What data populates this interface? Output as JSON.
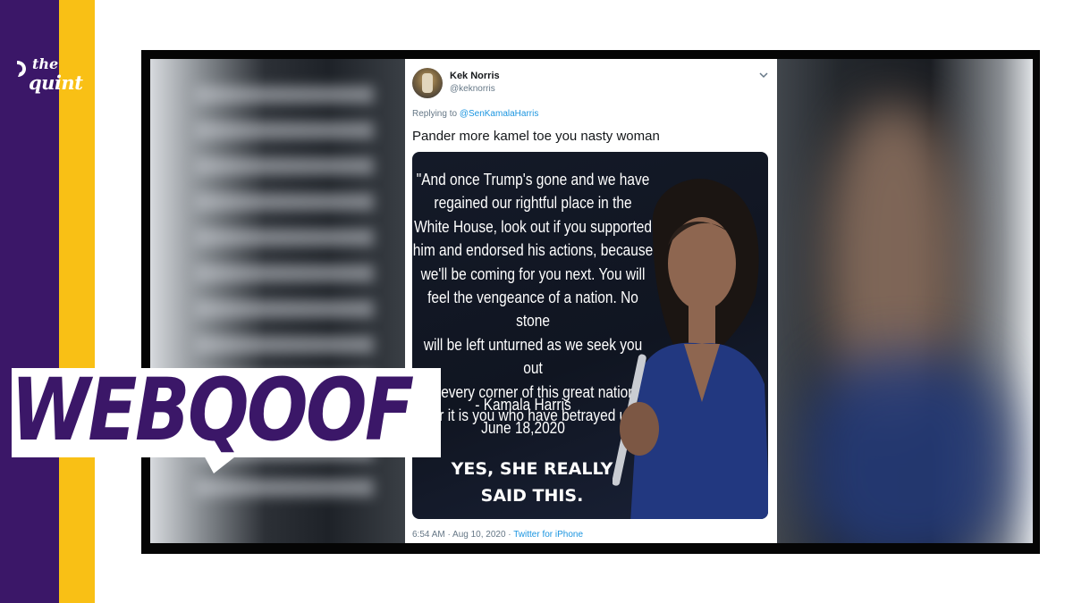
{
  "brand": {
    "logo_line1": "the",
    "logo_line2": "quint",
    "purple": "#3b1768",
    "yellow": "#f9c015"
  },
  "tweet": {
    "author_name": "Kek Norris",
    "author_handle": "@keknorris",
    "replying_prefix": "Replying to",
    "replying_to": "@SenKamalaHarris",
    "text": "Pander more kamel toe you nasty woman",
    "timestamp": "6:54 AM · Aug 10, 2020 · ",
    "source": "Twitter for iPhone",
    "menu_icon": "chevron-down-icon"
  },
  "meme": {
    "quote_lines": [
      "\"And once Trump's gone and we have",
      "regained our rightful place in the",
      "White House, look out if you supported",
      "him and endorsed his actions, because",
      "we'll be coming for you next. You will",
      "feel the vengeance of a nation. No stone",
      "will be left unturned as we seek you out",
      "in every corner of this great nation.",
      "For it is you who have betrayed us.\""
    ],
    "attribution_name": "- Kamala Harris",
    "attribution_date": "June 18,2020",
    "caption_line1": "YES, SHE REALLY",
    "caption_line2": "SAID THIS."
  },
  "tag": {
    "label": "WEBQOOF"
  }
}
